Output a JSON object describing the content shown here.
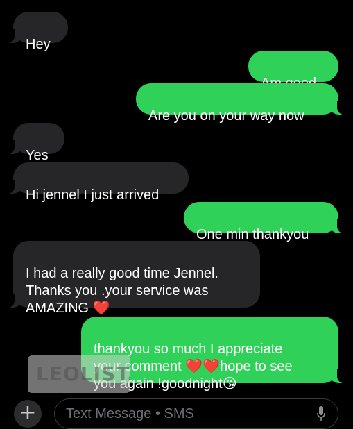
{
  "conversation": {
    "messages": [
      {
        "direction": "incoming",
        "text": "Hey"
      },
      {
        "direction": "outgoing",
        "text": "Am good"
      },
      {
        "direction": "outgoing",
        "text": "Are you on your way now"
      },
      {
        "direction": "incoming",
        "text": "Yes"
      },
      {
        "direction": "incoming",
        "text": "Hi jennel I just arrived"
      },
      {
        "direction": "outgoing",
        "text": "One min thankyou"
      },
      {
        "direction": "incoming",
        "text_before_emoji": "I had a really good time Jennel.\nThanks you .your service was\nAMAZING ",
        "emoji": "❤️"
      },
      {
        "direction": "outgoing",
        "line1": "thankyou so much I appreciate",
        "line2_before": "your comment ",
        "hearts": "❤️❤️",
        "line2_after": "hope to see",
        "line3": "you again !goodnight",
        "kiss_emoji": "😘"
      }
    ]
  },
  "watermark": {
    "text": "LEOLIST.cc"
  },
  "composer": {
    "plus_label": "+",
    "placeholder": "Text Message • SMS",
    "mic_icon": "microphone-icon"
  },
  "colors": {
    "background": "#000000",
    "incoming_bubble": "#262628",
    "outgoing_bubble": "#30d158",
    "text": "#ffffff"
  }
}
